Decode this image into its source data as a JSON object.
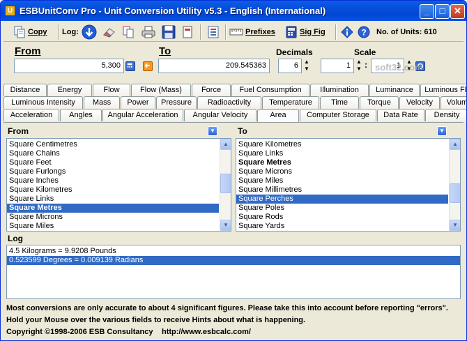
{
  "window": {
    "title": "ESBUnitConv Pro - Unit Conversion Utility v5.3 - English (International)",
    "app_icon": "ruler-icon",
    "controls": [
      "minimize-icon",
      "maximize-icon",
      "close-icon"
    ]
  },
  "toolbar": {
    "copy_label": "Copy",
    "log_label": "Log:",
    "prefixes_label": "Prefixes",
    "sigfig_label": "Sig Fig",
    "units_count": "No. of Units: 610"
  },
  "conversion": {
    "from_label": "From",
    "from_value": "5,300",
    "to_label": "To",
    "to_value": "209.545363",
    "decimals_label": "Decimals",
    "decimals_value": "6",
    "scale_label": "Scale",
    "scale_value_1": "1",
    "scale_value_2": "1",
    "scale_sep": ":"
  },
  "tabs": {
    "row1": [
      "Distance",
      "Energy",
      "Flow",
      "Flow (Mass)",
      "Force",
      "Fuel Consumption",
      "Illumination",
      "Luminance",
      "Luminous Flux"
    ],
    "row2": [
      "Luminous Intensity",
      "Mass",
      "Power",
      "Pressure",
      "Radioactivity",
      "Temperature",
      "Time",
      "Torque",
      "Velocity",
      "Volume"
    ],
    "row3": [
      "Acceleration",
      "Angles",
      "Angular Acceleration",
      "Angular Velocity",
      "Area",
      "Computer Storage",
      "Data Rate",
      "Density"
    ],
    "active": "Area"
  },
  "from_list": {
    "label": "From",
    "items": [
      {
        "text": "Square Centimetres"
      },
      {
        "text": "Square Chains"
      },
      {
        "text": "Square Feet"
      },
      {
        "text": "Square Furlongs"
      },
      {
        "text": "Square Inches"
      },
      {
        "text": "Square Kilometres"
      },
      {
        "text": "Square Links"
      },
      {
        "text": "Square Metres",
        "bold": true,
        "selected": true
      },
      {
        "text": "Square Microns"
      },
      {
        "text": "Square Miles"
      }
    ]
  },
  "to_list": {
    "label": "To",
    "items": [
      {
        "text": "Square Kilometres"
      },
      {
        "text": "Square Links"
      },
      {
        "text": "Square Metres",
        "bold": true
      },
      {
        "text": "Square Microns"
      },
      {
        "text": "Square Miles"
      },
      {
        "text": "Square Millimetres"
      },
      {
        "text": "Square Perches",
        "selected": true
      },
      {
        "text": "Square Poles"
      },
      {
        "text": "Square Rods"
      },
      {
        "text": "Square Yards"
      }
    ]
  },
  "log": {
    "label": "Log",
    "entries": [
      {
        "text": "4.5 Kilograms = 9.9208 Pounds"
      },
      {
        "text": "0.523599 Degrees = 0.009139 Radians",
        "selected": true
      }
    ]
  },
  "footer": {
    "line1": "Most conversions are only accurate to about 4 significant figures. Please take this into account before reporting \"errors\".",
    "line2": "Hold your Mouse over the various fields to receive Hints about what is happening.",
    "copyright": "Copyright ©1998-2006  ESB Consultancy",
    "url": "http://www.esbcalc.com/"
  },
  "watermark": "soft32.com",
  "colors": {
    "titlebar": "#0054e3",
    "selection": "#316ac5",
    "window_bg": "#ece9d8",
    "active_tab_accent": "#f9b846"
  }
}
